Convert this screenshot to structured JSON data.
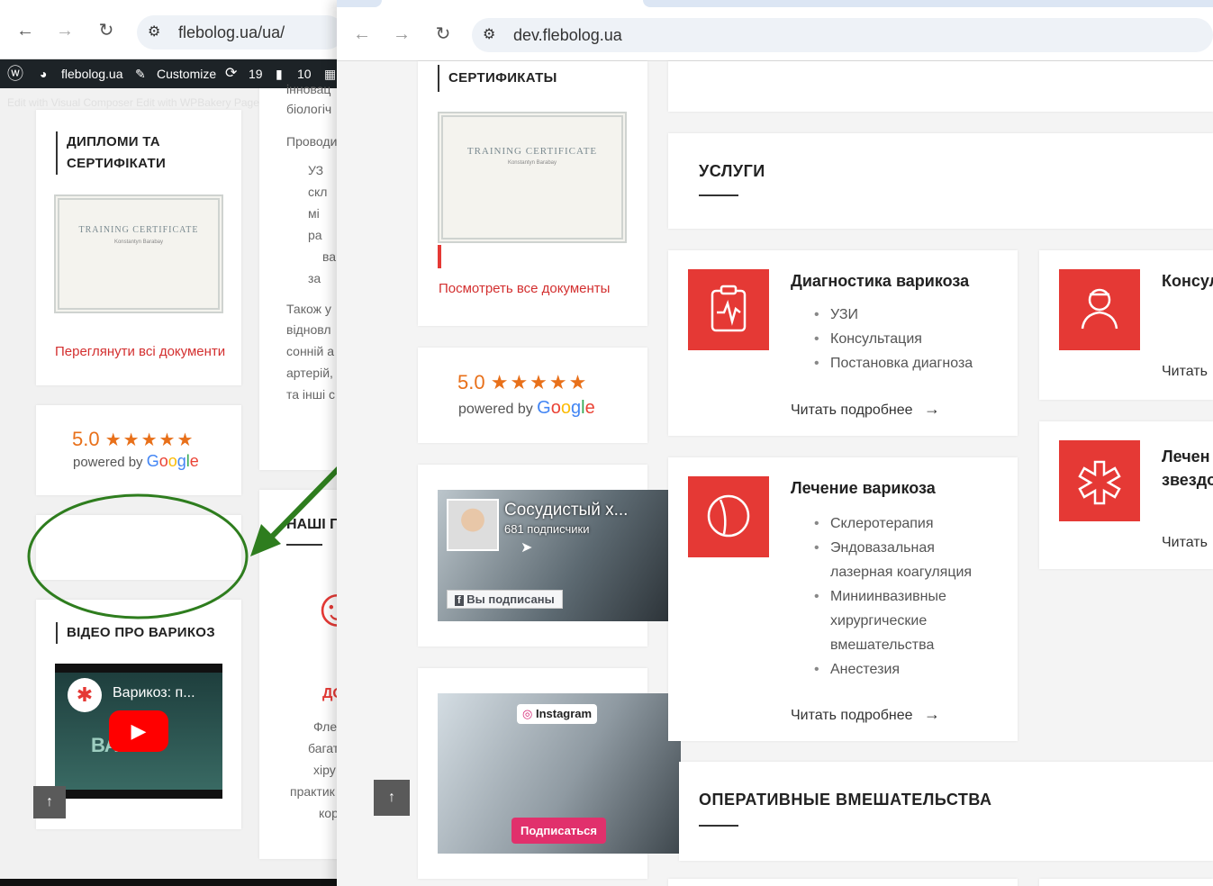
{
  "back_window": {
    "url": "flebolog.ua/ua/",
    "wpbar": {
      "site": "flebolog.ua",
      "customize": "Customize",
      "updates": "19",
      "comments": "10"
    },
    "edit_links": "Edit with Visual Composer   Edit with WPBakery Page",
    "diplomas_title_1": "ДИПЛОМИ ТА",
    "diplomas_title_2": "СЕРТИФІКАТИ",
    "certificate_title": "TRAINING CERTIFICATE",
    "certificate_name": "Konstantyn Barabay",
    "view_all": "Переглянути всі документи",
    "rating": "5.0",
    "powered_by": "powered by",
    "video_title": "ВІДЕО ПРО ВАРИКОЗ",
    "video_label": "Варикоз: п...",
    "video_overlay": "ВА      ОЗ",
    "snippets": [
      "інновац",
      "біологіч",
      "Проводи",
      "УЗ",
      "скл",
      "мі",
      "ра",
      "ва",
      "за",
      "Також у",
      "відновл",
      "сонній а",
      "артерій,",
      "та інші с",
      "НАШІ П",
      "ДО",
      "Фле",
      "багат",
      "хіру",
      "практик",
      "кор"
    ]
  },
  "front_window": {
    "url": "dev.flebolog.ua",
    "certificates_title": "СЕРТИФИКАТЫ",
    "certificate_title": "TRAINING CERTIFICATE",
    "certificate_name": "Konstantyn Barabay",
    "view_all": "Посмотреть все документы",
    "rating": "5.0",
    "powered_by": "powered by",
    "facebook": {
      "page_name": "Сосудистый х...",
      "followers": "681 подписчики",
      "subscribed": "Вы подписаны"
    },
    "instagram": {
      "label": "Instagram",
      "subscribe": "Подписаться"
    },
    "services_title": "УСЛУГИ",
    "services": [
      {
        "title": "Диагностика варикоза",
        "items": [
          "УЗИ",
          "Консультация",
          "Постановка диагноза"
        ],
        "more": "Читать подробнее",
        "icon": "clipboard-heart-icon"
      },
      {
        "title": "Лечение варикоза",
        "items": [
          "Склеротерапия",
          "Эндовазальная",
          "лазерная коагуляция",
          "Миниинвазивные",
          "хирургические",
          "вмешательства",
          "Анестезия"
        ],
        "more": "Читать подробнее",
        "icon": "leg-icon"
      }
    ],
    "services_right": [
      {
        "title": "Консул",
        "more": "Читать",
        "icon": "doctor-icon"
      },
      {
        "title_1": "Лечен",
        "title_2": "звездо",
        "more": "Читать",
        "icon": "medical-star-icon"
      }
    ],
    "operative_title": "ОПЕРАТИВНЫЕ ВМЕШАТЕЛЬСТВА"
  },
  "colors": {
    "accent_red": "#e53935",
    "arrow_green": "#2e7d1e",
    "rating_orange": "#e8701a"
  }
}
